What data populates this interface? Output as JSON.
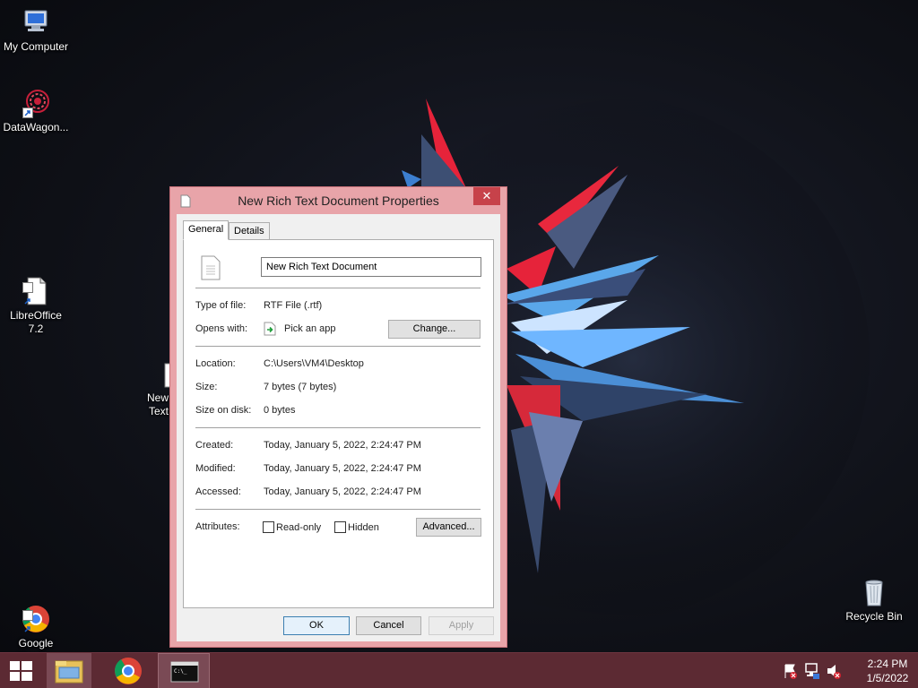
{
  "desktop": {
    "icons": [
      {
        "id": "my-computer",
        "label": "My Computer"
      },
      {
        "id": "datawagon",
        "label": "DataWagon..."
      },
      {
        "id": "libreoffice",
        "label": "LibreOffice\n7.2"
      },
      {
        "id": "new-text",
        "label": "New\nText"
      },
      {
        "id": "chrome",
        "label": "Google\nChrome"
      },
      {
        "id": "recycle-bin",
        "label": "Recycle Bin"
      }
    ]
  },
  "dialog": {
    "title": "New Rich Text Document Properties",
    "close_glyph": "✕",
    "tabs": [
      {
        "label": "General",
        "active": true
      },
      {
        "label": "Details",
        "active": false
      }
    ],
    "file_name": "New Rich Text Document",
    "rows": {
      "type_of_file": {
        "label": "Type of file:",
        "value": "RTF File (.rtf)"
      },
      "opens_with": {
        "label": "Opens with:",
        "value": "Pick an app",
        "button": "Change..."
      },
      "location": {
        "label": "Location:",
        "value": "C:\\Users\\VM4\\Desktop"
      },
      "size": {
        "label": "Size:",
        "value": "7 bytes (7 bytes)"
      },
      "size_on_disk": {
        "label": "Size on disk:",
        "value": "0 bytes"
      },
      "created": {
        "label": "Created:",
        "value": "Today, January 5, 2022, 2:24:47 PM"
      },
      "modified": {
        "label": "Modified:",
        "value": "Today, January 5, 2022, 2:24:47 PM"
      },
      "accessed": {
        "label": "Accessed:",
        "value": "Today, January 5, 2022, 2:24:47 PM"
      }
    },
    "attributes": {
      "label": "Attributes:",
      "read_only": {
        "label": "Read-only",
        "checked": false
      },
      "hidden": {
        "label": "Hidden",
        "checked": false
      },
      "advanced_button": "Advanced..."
    },
    "buttons": {
      "ok": "OK",
      "cancel": "Cancel",
      "apply": "Apply"
    }
  },
  "taskbar": {
    "clock": {
      "time": "2:24 PM",
      "date": "1/5/2022"
    },
    "apps": [
      "file-explorer",
      "chrome",
      "command-prompt"
    ],
    "tray_icons": [
      "action-center-flag-icon",
      "network-icon",
      "volume-muted-icon"
    ]
  },
  "colors": {
    "accent": "#e8a4a9",
    "close_red": "#c7424a",
    "taskbar": "#5c2a33"
  }
}
